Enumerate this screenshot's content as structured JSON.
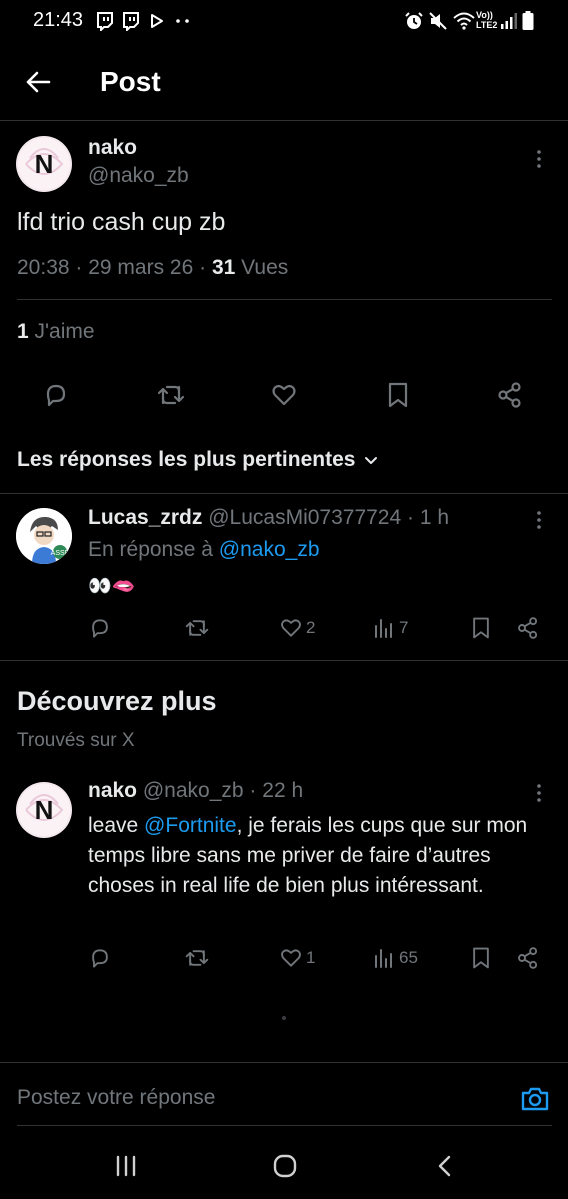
{
  "status_bar": {
    "time": "21:43",
    "network": "Vo))\nLTE2"
  },
  "header": {
    "title": "Post"
  },
  "post": {
    "display_name": "nako",
    "handle": "@nako_zb",
    "text": "lfd trio cash cup zb",
    "time": "20:38",
    "date": "29 mars 26",
    "views_count": "31",
    "views_label": "Vues",
    "likes_count": "1",
    "likes_label": "J'aime"
  },
  "replies_sort": {
    "label": "Les réponses les plus pertinentes"
  },
  "reply": {
    "display_name": "Lucas_zrdz",
    "handle": "@LucasMi07377724",
    "age": "1 h",
    "in_reply_prefix": "En réponse à",
    "in_reply_handle": "@nako_zb",
    "text": "👀🫦",
    "likes": "2",
    "views": "7"
  },
  "discover": {
    "title": "Découvrez plus",
    "subtitle": "Trouvés sur X"
  },
  "discover_post": {
    "display_name": "nako",
    "handle": "@nako_zb",
    "age": "22 h",
    "text_prefix": "leave ",
    "mention": "@Fortnite",
    "text_rest": ", je ferais les cups que sur mon temps libre sans me priver de faire d’autres choses in real life de bien plus intéressant.",
    "likes": "1",
    "views": "65"
  },
  "composer": {
    "placeholder": "Postez votre réponse"
  },
  "colors": {
    "background": "#000000",
    "text": "#e7e9ea",
    "muted": "#71767b",
    "accent": "#1d9bf0",
    "divider": "#2f3336"
  }
}
